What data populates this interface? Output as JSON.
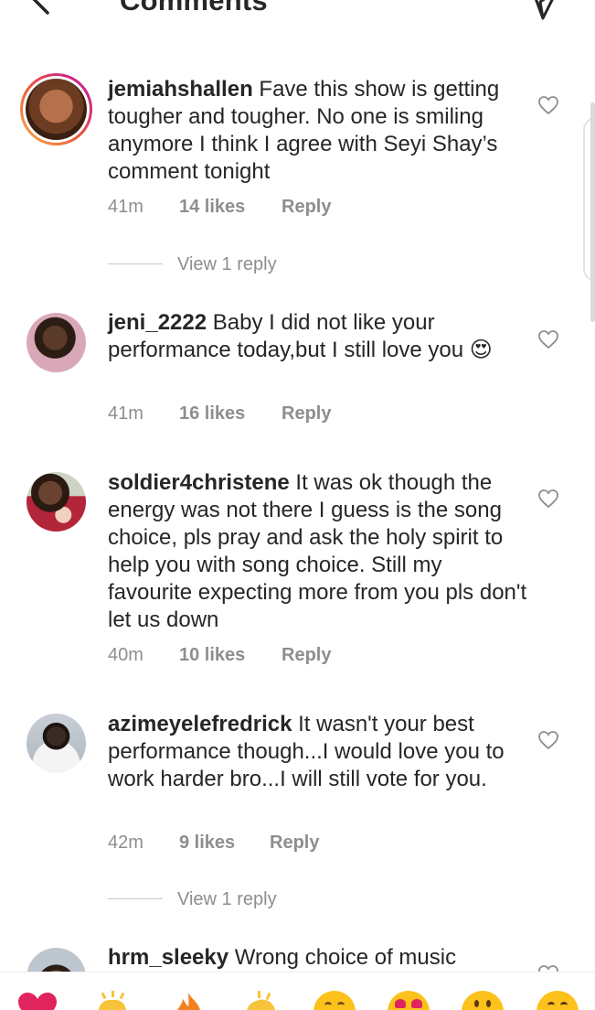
{
  "header": {
    "title": "Comments"
  },
  "comments": [
    {
      "username": "jemiahshallen",
      "text": "Fave this show is getting tougher and tougher. No one is smiling anymore I think I agree with Seyi Shay’s comment tonight",
      "time": "41m",
      "likes": "14 likes",
      "reply": "Reply",
      "view_replies": "View 1 reply"
    },
    {
      "username": "jeni_2222",
      "text": "Baby I did not like your performance today,but I still love you",
      "emoji": "😍",
      "time": "41m",
      "likes": "16 likes",
      "reply": "Reply"
    },
    {
      "username": "soldier4christene",
      "text": "It was ok though the energy was not there I guess is the song choice, pls pray and ask the holy spirit to help you with song choice. Still my favourite expecting more from you pls don't let us down",
      "time": "40m",
      "likes": "10 likes",
      "reply": "Reply"
    },
    {
      "username": "azimeyelefredrick",
      "text": "It wasn't your best performance though...I would love you to work harder bro...I will still vote for you.",
      "time": "42m",
      "likes": "9 likes",
      "reply": "Reply",
      "view_replies": "View 1 reply"
    },
    {
      "username": "hrm_sleeky",
      "text": "Wrong choice of music"
    }
  ],
  "emoji_bar": [
    "red-heart",
    "raising-hands",
    "fire",
    "clapping-hands",
    "crying-face",
    "heart-eyes-face",
    "astonished-face",
    "grinning-face"
  ]
}
